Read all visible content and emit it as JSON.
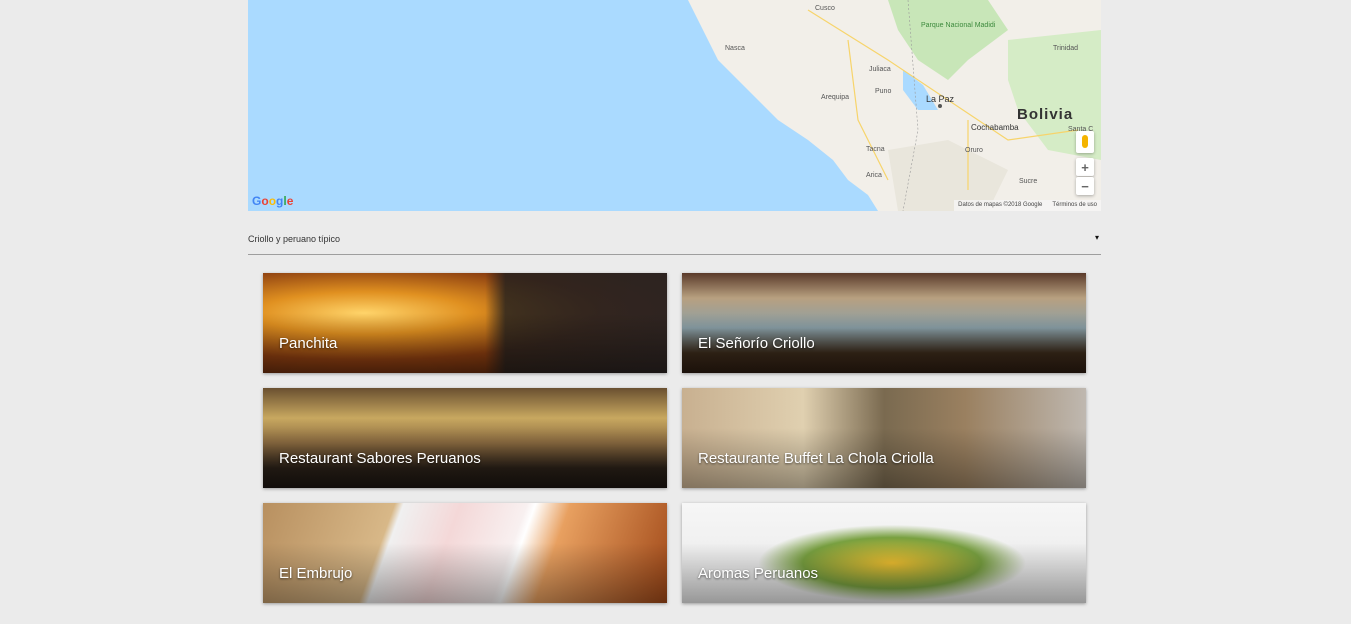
{
  "map": {
    "labels": {
      "cusco": "Cusco",
      "parque": "Parque Nacional Madidi",
      "trinidad": "Trinidad",
      "nasca": "Nasca",
      "juliaca": "Juliaca",
      "puno": "Puno",
      "arequipa": "Arequipa",
      "lapaz": "La Paz",
      "bolivia": "Bolivia",
      "cochabamba": "Cochabamba",
      "santacruz": "Santa C",
      "oruro": "Oruro",
      "tacna": "Tacna",
      "arica": "Arica",
      "sucre": "Sucre"
    },
    "attribution": "Datos de mapas ©2018 Google",
    "terms": "Términos de uso",
    "zoom_in": "+",
    "zoom_out": "−",
    "google_letters": [
      "G",
      "o",
      "o",
      "g",
      "l",
      "e"
    ]
  },
  "filter": {
    "selected": "Criollo y peruano típico",
    "arrow": "▾"
  },
  "restaurants": [
    {
      "name": "Panchita"
    },
    {
      "name": "El Señorío Criollo"
    },
    {
      "name": "Restaurant Sabores Peruanos"
    },
    {
      "name": "Restaurante Buffet La Chola Criolla"
    },
    {
      "name": "El Embrujo"
    },
    {
      "name": "Aromas Peruanos"
    }
  ],
  "colors": {
    "ocean": "#aadaff",
    "land": "#f2efe9",
    "park": "#c8e6b8",
    "page_bg": "#ebebeb"
  }
}
